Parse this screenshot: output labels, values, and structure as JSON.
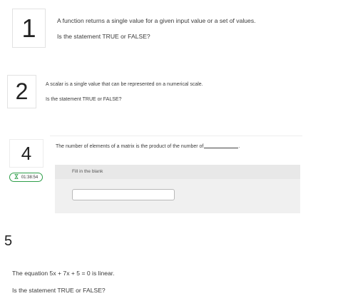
{
  "questions": [
    {
      "number": "1",
      "prompt": "A function returns a single value for a given input value or a set of values.",
      "question": "Is the statement TRUE or FALSE?"
    },
    {
      "number": "2",
      "prompt": "A scalar is a single value that can be represented on a numerical scale.",
      "question": "Is the statement TRUE or FALSE?"
    },
    {
      "number": "4",
      "prompt": "The number of elements of a matrix is the product of the number of",
      "prompt_tail": ".",
      "timer": "01:38:54",
      "fill_label": "Fill in the blank",
      "answer_value": ""
    },
    {
      "number": "5",
      "prompt": "The equation 5x + 7x + 5 = 0 is linear.",
      "question": "Is the statement TRUE or FALSE?"
    }
  ]
}
